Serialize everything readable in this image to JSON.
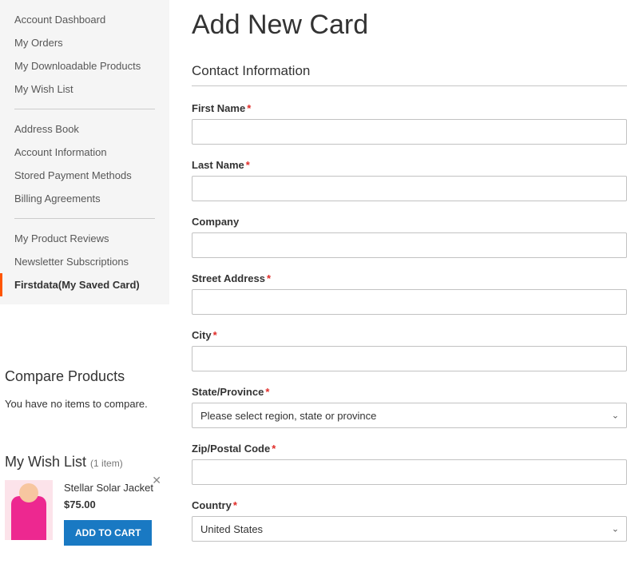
{
  "sidebar": {
    "nav": [
      {
        "label": "Account Dashboard"
      },
      {
        "label": "My Orders"
      },
      {
        "label": "My Downloadable Products"
      },
      {
        "label": "My Wish List"
      }
    ],
    "nav2": [
      {
        "label": "Address Book"
      },
      {
        "label": "Account Information"
      },
      {
        "label": "Stored Payment Methods"
      },
      {
        "label": "Billing Agreements"
      }
    ],
    "nav3": [
      {
        "label": "My Product Reviews"
      },
      {
        "label": "Newsletter Subscriptions"
      },
      {
        "label": "Firstdata(My Saved Card)"
      }
    ]
  },
  "compare": {
    "title": "Compare Products",
    "empty": "You have no items to compare."
  },
  "wishlist": {
    "title": "My Wish List",
    "count": "(1 item)",
    "item": {
      "name": "Stellar Solar Jacket",
      "price": "$75.00",
      "button": "ADD TO CART"
    }
  },
  "page": {
    "title": "Add New Card",
    "section": "Contact Information",
    "fields": {
      "first_name": "First Name",
      "last_name": "Last Name",
      "company": "Company",
      "street": "Street Address",
      "city": "City",
      "state": "State/Province",
      "state_placeholder": "Please select region, state or province",
      "zip": "Zip/Postal Code",
      "country": "Country",
      "country_value": "United States"
    }
  }
}
